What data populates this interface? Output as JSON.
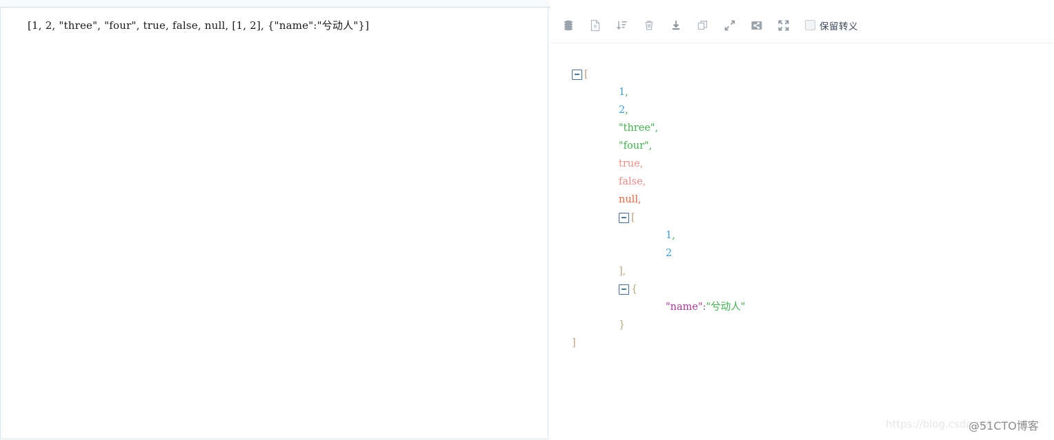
{
  "left_editor": {
    "name": "json-input-editor",
    "value": "[1, 2, \"three\", \"four\", true, false, null, [1, 2], {\"name\":\"兮动人\"}]"
  },
  "toolbar": {
    "buttons": [
      {
        "name": "database-icon",
        "title": "数据库"
      },
      {
        "name": "excel-file-icon",
        "title": "导出Excel"
      },
      {
        "name": "sort-descending-icon",
        "title": "排序"
      },
      {
        "name": "trash-icon",
        "title": "清空"
      },
      {
        "name": "download-icon",
        "title": "下载"
      },
      {
        "name": "copy-icon",
        "title": "复制"
      },
      {
        "name": "collapse-icon",
        "title": "折叠"
      },
      {
        "name": "share-icon",
        "title": "分享"
      },
      {
        "name": "expand-fullscreen-icon",
        "title": "全屏"
      }
    ],
    "keep_escape": {
      "label": "保留转义",
      "checked": false
    }
  },
  "json_tree": {
    "rows": [
      {
        "type": "open",
        "toggle": true,
        "indent": 0,
        "text": "["
      },
      {
        "type": "number",
        "indent": 1,
        "text": "1",
        "comma": ","
      },
      {
        "type": "number",
        "indent": 1,
        "text": "2",
        "comma": ","
      },
      {
        "type": "string",
        "indent": 1,
        "text": "\"three\"",
        "comma": ","
      },
      {
        "type": "string",
        "indent": 1,
        "text": "\"four\"",
        "comma": ","
      },
      {
        "type": "bool",
        "indent": 1,
        "text": "true",
        "comma": ","
      },
      {
        "type": "bool",
        "indent": 1,
        "text": "false",
        "comma": ","
      },
      {
        "type": "null",
        "indent": 1,
        "text": "null",
        "comma": ","
      },
      {
        "type": "open",
        "toggle": true,
        "indent": 1,
        "text": "["
      },
      {
        "type": "number",
        "indent": 2,
        "text": "1",
        "comma": ","
      },
      {
        "type": "number",
        "indent": 2,
        "text": "2",
        "comma": ""
      },
      {
        "type": "close",
        "indent": 1,
        "text": "]",
        "comma": ","
      },
      {
        "type": "open",
        "toggle": true,
        "indent": 1,
        "text": "{"
      },
      {
        "type": "pair",
        "indent": 2,
        "key": "\"name\"",
        "colon": ":",
        "value": "\"兮动人\""
      },
      {
        "type": "close",
        "indent": 1,
        "text": "}",
        "comma": ""
      },
      {
        "type": "close",
        "indent": 0,
        "text": "]",
        "comma": ""
      }
    ],
    "literal_rows": {
      "r0": "[",
      "r1": "1",
      "r2": "2",
      "r3": "\"three\"",
      "r4": "\"four\"",
      "r5": "true",
      "r6": "false",
      "r7": "null",
      "r8": "[",
      "r9": "1",
      "r10": "2",
      "r11": "]",
      "r12": "{",
      "r13_key": "\"name\"",
      "r13_colon": ":",
      "r13_value": "\"兮动人\"",
      "r14": "}",
      "r15": "]",
      "comma": ","
    }
  },
  "watermarks": {
    "csdn": "https://blog.csdn.net",
    "cto": "@51CTO博客"
  },
  "colors": {
    "number": "#3ca0e0",
    "string": "#3db34a",
    "boolean": "#f08a84",
    "null": "#f2663c",
    "key": "#a9379c",
    "bracket": "#b9a57f",
    "panel_border": "#d7e7f7"
  }
}
